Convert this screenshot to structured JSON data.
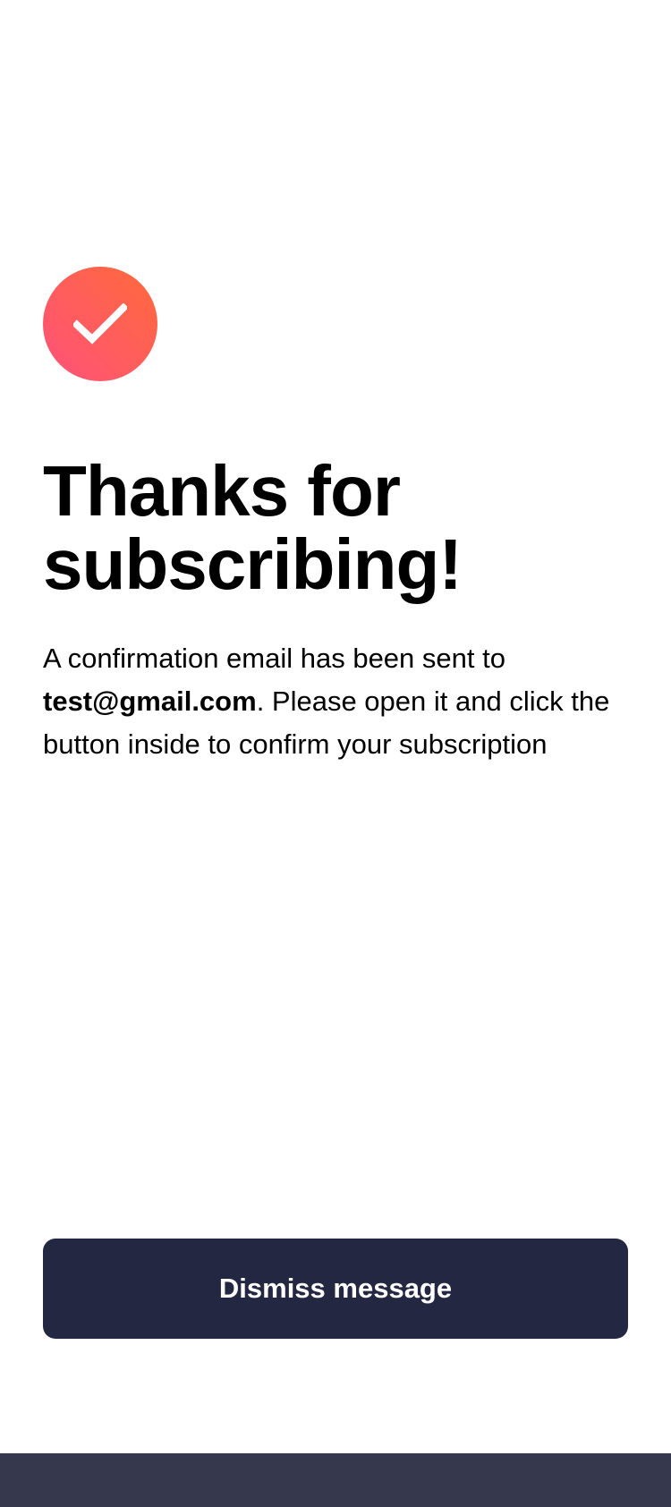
{
  "colors": {
    "background": "#ffffff",
    "accent_gradient_start": "#ff6a3a",
    "accent_gradient_end": "#ff527b",
    "button_background": "#232742",
    "button_text": "#ffffff",
    "footer_bar": "#36384e",
    "text": "#000000"
  },
  "success_icon": {
    "icon": "checkmark-icon"
  },
  "heading": {
    "title": "Thanks for subscribing!"
  },
  "message": {
    "prefix": "A confirmation email has been sent to",
    "email": "test@gmail.com",
    "suffix": ". Please open it and click the button inside to confirm your subscription"
  },
  "actions": {
    "dismiss_label": "Dismiss message"
  }
}
